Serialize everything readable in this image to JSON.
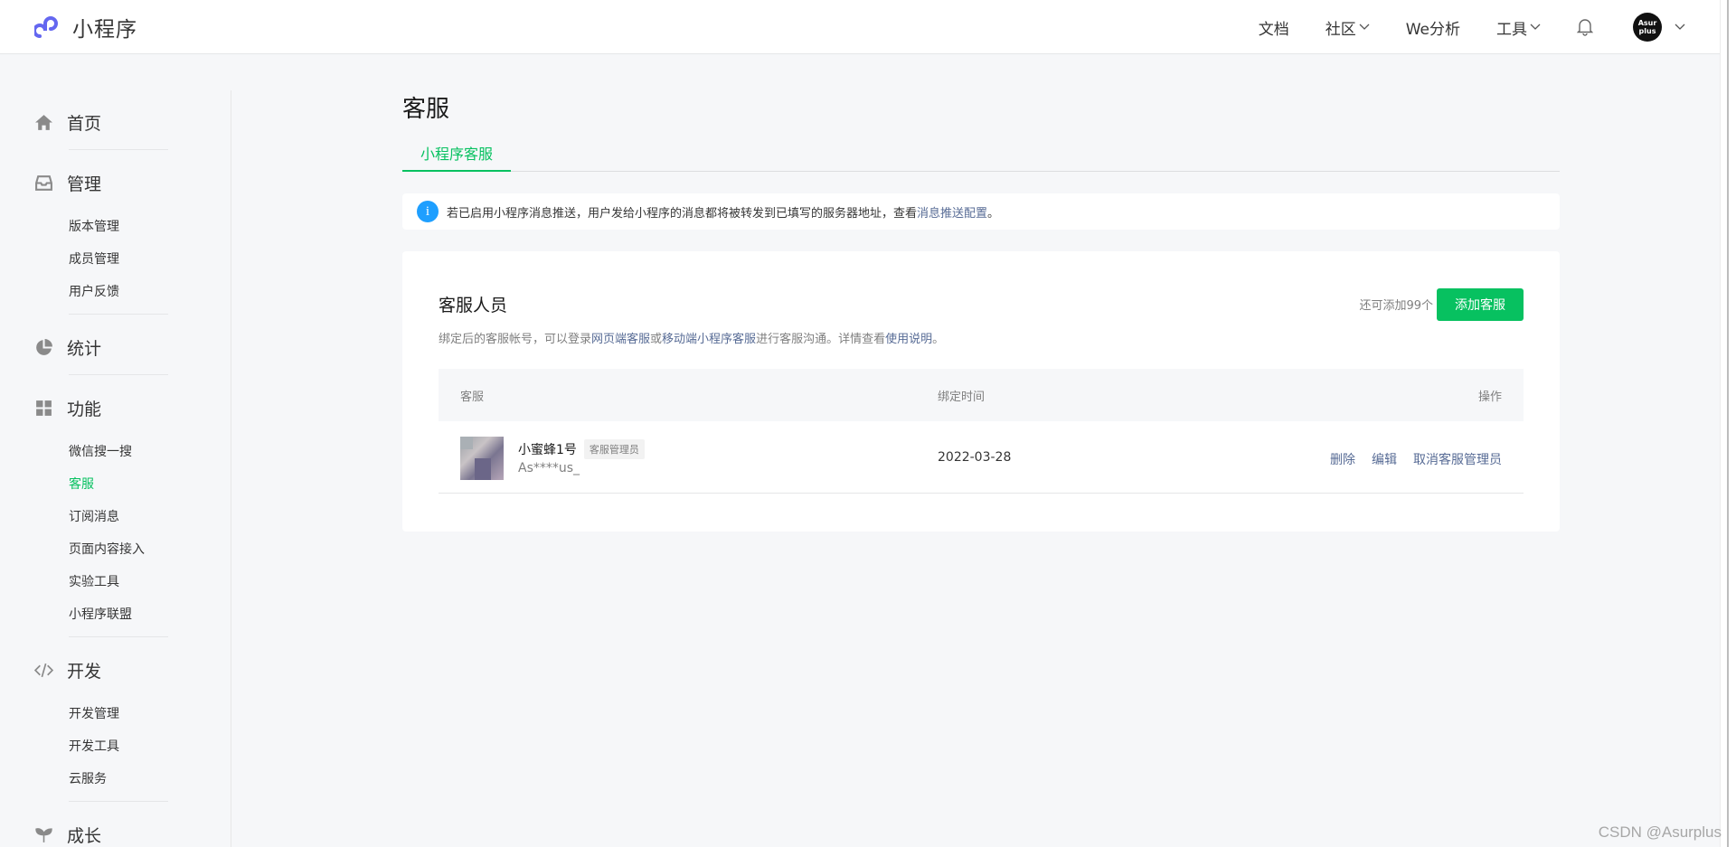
{
  "app": {
    "title": "小程序",
    "brand_color": "#6467f0",
    "accent_color": "#07c160",
    "link_color": "#576b95"
  },
  "topnav": {
    "docs": "文档",
    "community": "社区",
    "analytics": "We分析",
    "tools": "工具",
    "avatar_text": "Asurplus"
  },
  "sidebar": {
    "home": "首页",
    "manage": {
      "label": "管理",
      "items": [
        "版本管理",
        "成员管理",
        "用户反馈"
      ]
    },
    "stats": "统计",
    "features": {
      "label": "功能",
      "items": [
        "微信搜一搜",
        "客服",
        "订阅消息",
        "页面内容接入",
        "实验工具",
        "小程序联盟"
      ]
    },
    "develop": {
      "label": "开发",
      "items": [
        "开发管理",
        "开发工具",
        "云服务"
      ]
    },
    "growth": "成长"
  },
  "page": {
    "title": "客服",
    "tab": "小程序客服",
    "notice": {
      "text": "若已启用小程序消息推送，用户发给小程序的消息都将被转发到已填写的服务器地址，查看 ",
      "link": "消息推送配置",
      "end": "。"
    }
  },
  "card": {
    "title": "客服人员",
    "desc_1": "绑定后的客服帐号，可以登录",
    "desc_link_1": "网页端客服",
    "desc_2": "或",
    "desc_link_2": "移动端小程序客服",
    "desc_3": "进行客服沟通。详情查看",
    "desc_link_3": "使用说明",
    "desc_4": "。",
    "remaining": "还可添加99个",
    "add_button": "添加客服",
    "table": {
      "headers": [
        "客服",
        "绑定时间",
        "操作"
      ],
      "rows": [
        {
          "name": "小蜜蜂1号",
          "role": "客服管理员",
          "account": "As****us_",
          "date": "2022-03-28",
          "actions": [
            "删除",
            "编辑",
            "取消客服管理员"
          ]
        }
      ]
    }
  },
  "watermark": "CSDN @Asurplus"
}
